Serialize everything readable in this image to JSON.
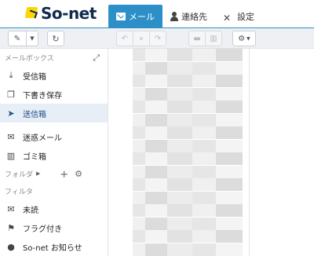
{
  "header": {
    "logo_text": "So-net",
    "tabs": [
      {
        "label": "メール",
        "icon": "mail-icon",
        "active": true
      },
      {
        "label": "連絡先",
        "icon": "contacts-icon",
        "active": false
      },
      {
        "label": "設定",
        "icon": "settings-tools-icon",
        "active": false
      }
    ],
    "accent_color": "#2d8fc8"
  },
  "toolbar": {
    "compose_icon": "pencil-icon",
    "compose_dropdown_icon": "caret-down-icon",
    "refresh_icon": "refresh-icon",
    "reply_icon": "reply-icon",
    "reply_all_icon": "reply-all-icon",
    "forward_icon": "forward-icon",
    "archive_icon": "archive-icon",
    "delete_icon": "trash-icon",
    "more_icon": "gear-icon"
  },
  "sidebar": {
    "mailbox_header": "メールボックス",
    "mailboxes": [
      {
        "label": "受信箱",
        "icon": "inbox-icon"
      },
      {
        "label": "下書き保存",
        "icon": "drafts-icon"
      },
      {
        "label": "送信箱",
        "icon": "sent-icon",
        "active": true
      },
      {
        "label": "迷惑メール",
        "icon": "spam-icon"
      },
      {
        "label": "ゴミ箱",
        "icon": "trash-icon"
      }
    ],
    "folders_header": "フォルダ",
    "filters_header": "フィルタ",
    "filters": [
      {
        "label": "未読",
        "icon": "unread-icon"
      },
      {
        "label": "フラグ付き",
        "icon": "flag-icon"
      },
      {
        "label": "So-net お知らせ",
        "icon": "info-icon"
      }
    ]
  }
}
